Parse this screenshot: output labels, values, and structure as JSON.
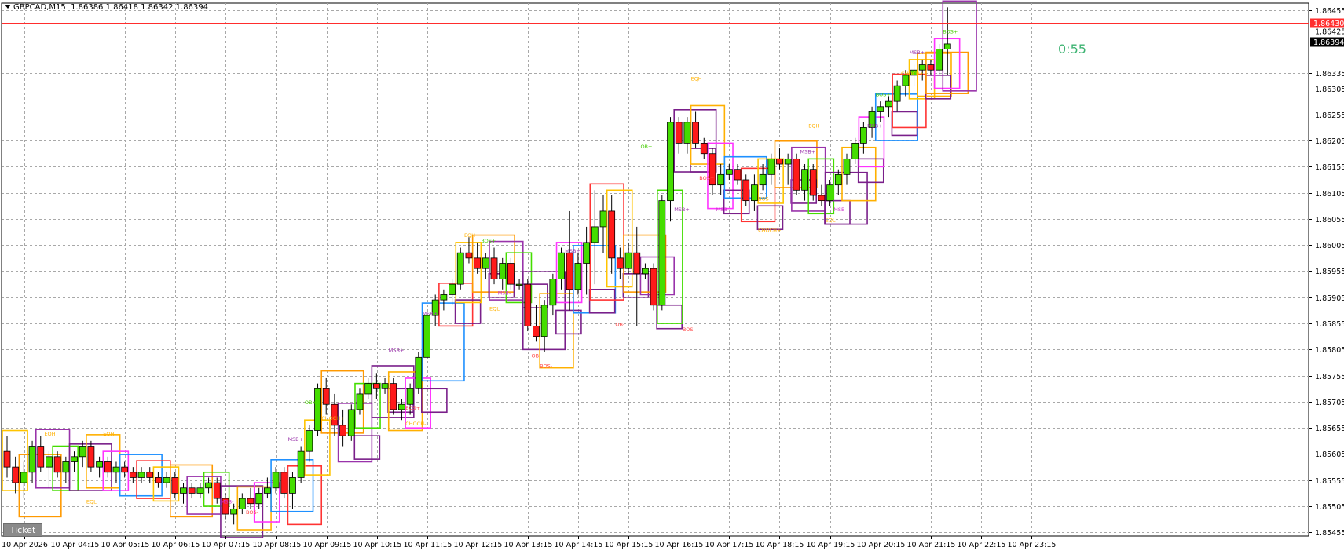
{
  "header": {
    "symbol": "GBPCAD,M15",
    "ohlc": "1.86386 1.86418 1.86342 1.86394"
  },
  "countdown": "0:55",
  "ticket_label": "Ticket",
  "price_axis": {
    "ticks": [
      "1.86455",
      "1.86395",
      "1.86335",
      "1.86305",
      "1.86255",
      "1.86205",
      "1.86155",
      "1.86105",
      "1.86055",
      "1.86005",
      "1.85955",
      "1.85905",
      "1.85855",
      "1.85805",
      "1.85755",
      "1.85705",
      "1.85655",
      "1.85605",
      "1.85555",
      "1.85505",
      "1.85455"
    ],
    "ask_label": "1.86430",
    "bid_label": "1.86394",
    "hidden_label": "1.86425"
  },
  "time_axis": {
    "ticks": [
      "10 Apr 2026",
      "10 Apr 04:15",
      "10 Apr 05:15",
      "10 Apr 06:15",
      "10 Apr 07:15",
      "10 Apr 08:15",
      "10 Apr 09:15",
      "10 Apr 10:15",
      "10 Apr 11:15",
      "10 Apr 12:15",
      "10 Apr 13:15",
      "10 Apr 14:15",
      "10 Apr 15:15",
      "10 Apr 16:15",
      "10 Apr 17:15",
      "10 Apr 18:15",
      "10 Apr 19:15",
      "10 Apr 20:15",
      "10 Apr 21:15",
      "10 Apr 22:15",
      "10 Apr 23:15"
    ]
  },
  "colors": {
    "bull": "#44dd00",
    "bear": "#ff1a1a",
    "grid": "#a8a8a8",
    "ask_line": "#ff2d2d",
    "bid_line": "#9bb7c6"
  },
  "chart_data": {
    "type": "candlestick",
    "title": "GBPCAD,M15",
    "ylim": [
      1.85448,
      1.86468
    ],
    "candles": [
      [
        1.8561,
        1.8564,
        1.8556,
        1.8558
      ],
      [
        1.8558,
        1.856,
        1.8553,
        1.8555
      ],
      [
        1.8555,
        1.8559,
        1.8552,
        1.8557
      ],
      [
        1.8557,
        1.8563,
        1.8555,
        1.8562
      ],
      [
        1.8562,
        1.8564,
        1.8557,
        1.8558
      ],
      [
        1.8558,
        1.8561,
        1.8554,
        1.856
      ],
      [
        1.856,
        1.8561,
        1.8556,
        1.8557
      ],
      [
        1.8557,
        1.856,
        1.8555,
        1.8559
      ],
      [
        1.8559,
        1.8561,
        1.8557,
        1.856
      ],
      [
        1.856,
        1.8563,
        1.8558,
        1.8562
      ],
      [
        1.8562,
        1.8563,
        1.8557,
        1.8558
      ],
      [
        1.8558,
        1.856,
        1.8556,
        1.8559
      ],
      [
        1.8559,
        1.856,
        1.8556,
        1.8557
      ],
      [
        1.8557,
        1.8559,
        1.8555,
        1.8558
      ],
      [
        1.8558,
        1.8559,
        1.8556,
        1.8557
      ],
      [
        1.8557,
        1.8558,
        1.8555,
        1.8556
      ],
      [
        1.8556,
        1.8558,
        1.8555,
        1.8557
      ],
      [
        1.8557,
        1.8558,
        1.8555,
        1.8556
      ],
      [
        1.8556,
        1.8557,
        1.8554,
        1.8555
      ],
      [
        1.8555,
        1.8557,
        1.8554,
        1.8556
      ],
      [
        1.8556,
        1.8557,
        1.8552,
        1.8553
      ],
      [
        1.8553,
        1.8555,
        1.8551,
        1.8554
      ],
      [
        1.8554,
        1.8555,
        1.8552,
        1.8553
      ],
      [
        1.8553,
        1.8555,
        1.8552,
        1.8554
      ],
      [
        1.8554,
        1.8556,
        1.8553,
        1.8555
      ],
      [
        1.8555,
        1.8556,
        1.8551,
        1.8552
      ],
      [
        1.8552,
        1.8553,
        1.8548,
        1.8549
      ],
      [
        1.8549,
        1.8551,
        1.8547,
        1.855
      ],
      [
        1.855,
        1.8553,
        1.8549,
        1.8552
      ],
      [
        1.8552,
        1.8554,
        1.855,
        1.8551
      ],
      [
        1.8551,
        1.8554,
        1.855,
        1.8553
      ],
      [
        1.8553,
        1.8556,
        1.8552,
        1.8554
      ],
      [
        1.8554,
        1.8558,
        1.8553,
        1.8557
      ],
      [
        1.8557,
        1.8558,
        1.8552,
        1.8553
      ],
      [
        1.8553,
        1.8557,
        1.855,
        1.8556
      ],
      [
        1.8556,
        1.8562,
        1.8555,
        1.8561
      ],
      [
        1.8561,
        1.8566,
        1.8559,
        1.8565
      ],
      [
        1.8565,
        1.8574,
        1.8564,
        1.8573
      ],
      [
        1.8573,
        1.8575,
        1.8568,
        1.857
      ],
      [
        1.857,
        1.8572,
        1.8564,
        1.8566
      ],
      [
        1.8566,
        1.8569,
        1.8562,
        1.8564
      ],
      [
        1.8564,
        1.857,
        1.8563,
        1.8569
      ],
      [
        1.8569,
        1.8573,
        1.8568,
        1.8572
      ],
      [
        1.8572,
        1.8575,
        1.8571,
        1.8574
      ],
      [
        1.8574,
        1.8576,
        1.8571,
        1.8573
      ],
      [
        1.8573,
        1.8575,
        1.8572,
        1.8574
      ],
      [
        1.8574,
        1.8575,
        1.8568,
        1.8569
      ],
      [
        1.8569,
        1.8571,
        1.8567,
        1.857
      ],
      [
        1.857,
        1.8574,
        1.8568,
        1.8573
      ],
      [
        1.8573,
        1.858,
        1.8572,
        1.8579
      ],
      [
        1.8579,
        1.8588,
        1.8578,
        1.8587
      ],
      [
        1.8587,
        1.8591,
        1.8585,
        1.859
      ],
      [
        1.859,
        1.8592,
        1.8588,
        1.8591
      ],
      [
        1.8591,
        1.8594,
        1.8589,
        1.8593
      ],
      [
        1.8593,
        1.86,
        1.8592,
        1.8599
      ],
      [
        1.8599,
        1.8602,
        1.8597,
        1.8598
      ],
      [
        1.8598,
        1.8601,
        1.8595,
        1.8596
      ],
      [
        1.8596,
        1.8599,
        1.8594,
        1.8598
      ],
      [
        1.8598,
        1.86,
        1.8593,
        1.8594
      ],
      [
        1.8594,
        1.8598,
        1.8592,
        1.8597
      ],
      [
        1.8597,
        1.8598,
        1.8592,
        1.8593
      ],
      [
        1.8593,
        1.8594,
        1.8592,
        1.8593
      ],
      [
        1.8593,
        1.8594,
        1.8584,
        1.8585
      ],
      [
        1.8585,
        1.8589,
        1.8582,
        1.8583
      ],
      [
        1.8583,
        1.859,
        1.858,
        1.8589
      ],
      [
        1.8589,
        1.8595,
        1.8587,
        1.8594
      ],
      [
        1.8594,
        1.86,
        1.8592,
        1.8599
      ],
      [
        1.8599,
        1.8607,
        1.8588,
        1.8592
      ],
      [
        1.8592,
        1.8599,
        1.8591,
        1.8597
      ],
      [
        1.8597,
        1.8604,
        1.8591,
        1.8601
      ],
      [
        1.8601,
        1.8611,
        1.8593,
        1.8604
      ],
      [
        1.8604,
        1.861,
        1.8599,
        1.8607
      ],
      [
        1.8607,
        1.861,
        1.8595,
        1.8598
      ],
      [
        1.8598,
        1.86,
        1.8594,
        1.8596
      ],
      [
        1.8596,
        1.8601,
        1.8595,
        1.8599
      ],
      [
        1.8599,
        1.8604,
        1.8585,
        1.8595
      ],
      [
        1.8595,
        1.8597,
        1.8594,
        1.8596
      ],
      [
        1.8596,
        1.8597,
        1.8588,
        1.8589
      ],
      [
        1.8589,
        1.861,
        1.8588,
        1.8609
      ],
      [
        1.8609,
        1.8625,
        1.8605,
        1.8624
      ],
      [
        1.8624,
        1.8625,
        1.8618,
        1.862
      ],
      [
        1.862,
        1.8625,
        1.8618,
        1.8624
      ],
      [
        1.8624,
        1.8626,
        1.8619,
        1.862
      ],
      [
        1.862,
        1.8621,
        1.8617,
        1.8618
      ],
      [
        1.8618,
        1.8619,
        1.861,
        1.8612
      ],
      [
        1.8612,
        1.8616,
        1.861,
        1.8614
      ],
      [
        1.8614,
        1.8616,
        1.8613,
        1.8615
      ],
      [
        1.8615,
        1.8616,
        1.8612,
        1.8613
      ],
      [
        1.8613,
        1.8614,
        1.8608,
        1.8609
      ],
      [
        1.8609,
        1.8614,
        1.8607,
        1.8612
      ],
      [
        1.8612,
        1.8616,
        1.8611,
        1.8614
      ],
      [
        1.8614,
        1.8618,
        1.8612,
        1.8617
      ],
      [
        1.8617,
        1.8619,
        1.8615,
        1.8616
      ],
      [
        1.8616,
        1.8618,
        1.8612,
        1.8617
      ],
      [
        1.8617,
        1.8618,
        1.861,
        1.8611
      ],
      [
        1.8611,
        1.8616,
        1.8609,
        1.8615
      ],
      [
        1.8615,
        1.8616,
        1.8609,
        1.861
      ],
      [
        1.861,
        1.8612,
        1.8608,
        1.8609
      ],
      [
        1.8609,
        1.8613,
        1.8608,
        1.8612
      ],
      [
        1.8612,
        1.8615,
        1.861,
        1.8614
      ],
      [
        1.8614,
        1.8618,
        1.8612,
        1.8617
      ],
      [
        1.8617,
        1.8621,
        1.8616,
        1.862
      ],
      [
        1.862,
        1.8624,
        1.8618,
        1.8623
      ],
      [
        1.8623,
        1.8627,
        1.8621,
        1.8626
      ],
      [
        1.8626,
        1.8628,
        1.8624,
        1.8627
      ],
      [
        1.8627,
        1.8629,
        1.8625,
        1.8628
      ],
      [
        1.8628,
        1.8632,
        1.8626,
        1.8631
      ],
      [
        1.8631,
        1.8634,
        1.8629,
        1.8633
      ],
      [
        1.8633,
        1.8635,
        1.8631,
        1.8634
      ],
      [
        1.8634,
        1.8636,
        1.8632,
        1.8635
      ],
      [
        1.8635,
        1.8636,
        1.8633,
        1.8634
      ],
      [
        1.8634,
        1.8639,
        1.8633,
        1.8638
      ],
      [
        1.8638,
        1.8646,
        1.8633,
        1.8639
      ]
    ]
  },
  "annotations": [
    {
      "text": "EQH",
      "c": "#ffb000",
      "i": 5,
      "p": 1.8564
    },
    {
      "text": "EQH",
      "c": "#ffb000",
      "i": 12,
      "p": 1.8564
    },
    {
      "text": "EQL",
      "c": "#ffb000",
      "i": 10,
      "p": 1.8551
    },
    {
      "text": "MSB-",
      "c": "#cc33cc",
      "i": 26,
      "p": 1.8551
    },
    {
      "text": "BOS-",
      "c": "#ff4444",
      "i": 29,
      "p": 1.8549
    },
    {
      "text": "MSB+",
      "c": "#9933aa",
      "i": 34,
      "p": 1.8563
    },
    {
      "text": "OB+",
      "c": "#44cc00",
      "i": 36,
      "p": 1.857
    },
    {
      "text": "CHOCH+",
      "c": "#ffb000",
      "i": 38,
      "p": 1.8567
    },
    {
      "text": "MSB+",
      "c": "#9933aa",
      "i": 46,
      "p": 1.858
    },
    {
      "text": "BOS+",
      "c": "#ff4444",
      "i": 48,
      "p": 1.8569
    },
    {
      "text": "CHOCH-",
      "c": "#ffb000",
      "i": 48,
      "p": 1.8566
    },
    {
      "text": "MSB+",
      "c": "#9933aa",
      "i": 50,
      "p": 1.8587
    },
    {
      "text": "EQH",
      "c": "#ffb000",
      "i": 55,
      "p": 1.8602
    },
    {
      "text": "BOS+",
      "c": "#44cc00",
      "i": 57,
      "p": 1.8601
    },
    {
      "text": "EQL",
      "c": "#ffb000",
      "i": 58,
      "p": 1.8588
    },
    {
      "text": "MSB-",
      "c": "#cc33cc",
      "i": 59,
      "p": 1.8591
    },
    {
      "text": "OB-",
      "c": "#ff4444",
      "i": 63,
      "p": 1.8579
    },
    {
      "text": "BOS-",
      "c": "#ff4444",
      "i": 64,
      "p": 1.8577
    },
    {
      "text": "MSB+",
      "c": "#9933aa",
      "i": 67,
      "p": 1.8599
    },
    {
      "text": "OB-",
      "c": "#ff4444",
      "i": 73,
      "p": 1.8585
    },
    {
      "text": "OB+",
      "c": "#44cc00",
      "i": 76,
      "p": 1.8619
    },
    {
      "text": "MSB+",
      "c": "#9933aa",
      "i": 80,
      "p": 1.8607
    },
    {
      "text": "BOS-",
      "c": "#ff4444",
      "i": 81,
      "p": 1.8584
    },
    {
      "text": "EQH",
      "c": "#ffb000",
      "i": 82,
      "p": 1.8632
    },
    {
      "text": "BOS+",
      "c": "#ff4444",
      "i": 83,
      "p": 1.8613
    },
    {
      "text": "MSB-",
      "c": "#cc33cc",
      "i": 85,
      "p": 1.8607
    },
    {
      "text": "CHOCH+",
      "c": "#ffb000",
      "i": 90,
      "p": 1.8603
    },
    {
      "text": "BOS-",
      "c": "#ffb000",
      "i": 90,
      "p": 1.8609
    },
    {
      "text": "EQH",
      "c": "#ffb000",
      "i": 96,
      "p": 1.8623
    },
    {
      "text": "MSB+",
      "c": "#9933aa",
      "i": 95,
      "p": 1.8618
    },
    {
      "text": "EQL",
      "c": "#ffb000",
      "i": 98,
      "p": 1.8605
    },
    {
      "text": "MSB-",
      "c": "#cc33cc",
      "i": 99,
      "p": 1.8607
    },
    {
      "text": "MSB+",
      "c": "#9933aa",
      "i": 103,
      "p": 1.8623
    },
    {
      "text": "BOS+",
      "c": "#44cc00",
      "i": 104,
      "p": 1.8629
    },
    {
      "text": "CHOCH+",
      "c": "#ffb000",
      "i": 107,
      "p": 1.8633
    },
    {
      "text": "MSB+",
      "c": "#9933aa",
      "i": 108,
      "p": 1.8637
    },
    {
      "text": "BOS+",
      "c": "#44cc00",
      "i": 112,
      "p": 1.8641
    }
  ]
}
